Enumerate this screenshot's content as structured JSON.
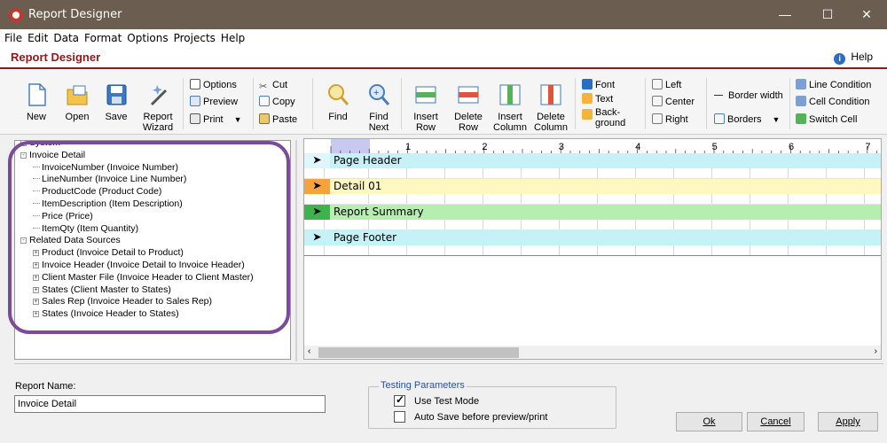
{
  "window": {
    "title": "Report Designer",
    "minimize": "—",
    "maximize": "☐",
    "close": "✕"
  },
  "menu": [
    "File",
    "Edit",
    "Data",
    "Format",
    "Options",
    "Projects",
    "Help"
  ],
  "header": {
    "title": "Report Designer",
    "help_label": "Help"
  },
  "ribbon": {
    "new": "New",
    "open": "Open",
    "save": "Save",
    "report_wizard": [
      "Report",
      "Wizard"
    ],
    "options": "Options",
    "preview": "Preview",
    "print": "Print",
    "cut": "Cut",
    "copy": "Copy",
    "paste": "Paste",
    "find": "Find",
    "find_next": [
      "Find",
      "Next"
    ],
    "insert_row": [
      "Insert",
      "Row"
    ],
    "delete_row": [
      "Delete",
      "Row"
    ],
    "insert_column": [
      "Insert",
      "Column"
    ],
    "delete_column": [
      "Delete",
      "Column"
    ],
    "font": "Font",
    "text": "Text",
    "background": [
      "Back-",
      "ground"
    ],
    "left": "Left",
    "center": "Center",
    "right": "Right",
    "border_width": "Border width",
    "borders": "Borders",
    "line_condition": "Line Condition",
    "cell_condition": "Cell Condition",
    "switch_cell": "Switch Cell"
  },
  "tree": {
    "items": [
      {
        "text": "System",
        "level": 0,
        "toggle": "-"
      },
      {
        "text": "Invoice Detail",
        "level": 0,
        "toggle": "-"
      },
      {
        "text": "InvoiceNumber (Invoice Number)",
        "level": 1
      },
      {
        "text": "LineNumber (Invoice Line Number)",
        "level": 1
      },
      {
        "text": "ProductCode (Product Code)",
        "level": 1
      },
      {
        "text": "ItemDescription (Item Description)",
        "level": 1
      },
      {
        "text": "Price (Price)",
        "level": 1
      },
      {
        "text": "ItemQty (Item Quantity)",
        "level": 1
      },
      {
        "text": "Related Data Sources",
        "level": 0,
        "toggle": "-"
      },
      {
        "text": "Product (Invoice Detail to Product)",
        "level": 1,
        "toggle": "+"
      },
      {
        "text": "Invoice Header (Invoice Detail to Invoice Header)",
        "level": 1,
        "toggle": "+"
      },
      {
        "text": "Client Master File (Invoice Header to Client Master)",
        "level": 1,
        "toggle": "+"
      },
      {
        "text": "States (Client Master to States)",
        "level": 1,
        "toggle": "+"
      },
      {
        "text": "Sales Rep (Invoice Header to Sales Rep)",
        "level": 1,
        "toggle": "+"
      },
      {
        "text": "States (Invoice Header to States)",
        "level": 1,
        "toggle": "+"
      }
    ]
  },
  "ruler": {
    "marks": [
      "1",
      "2",
      "3",
      "4",
      "5",
      "6",
      "7"
    ]
  },
  "bands": [
    {
      "label": "Page Header",
      "color": "#c6f1f7",
      "arrow_color": "#dff6fa"
    },
    {
      "label": "Detail 01",
      "color": "#fff7c2",
      "arrow_color": "#f7a23a"
    },
    {
      "label": "Report Summary",
      "color": "#b6eeb0",
      "arrow_color": "#3cb44b"
    },
    {
      "label": "Page Footer",
      "color": "#c6f1f7",
      "arrow_color": "#c6f1f7"
    }
  ],
  "report_name": {
    "label": "Report Name:",
    "value": "Invoice Detail"
  },
  "testing": {
    "legend": "Testing Parameters",
    "use_test_mode": {
      "label": "Use Test Mode",
      "checked": true
    },
    "auto_save": {
      "label": "Auto Save before preview/print",
      "checked": false
    }
  },
  "buttons": {
    "ok": "Ok",
    "cancel": "Cancel",
    "apply": "Apply"
  }
}
